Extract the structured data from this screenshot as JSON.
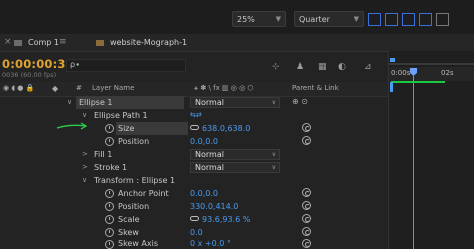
{
  "viewer": {
    "zoom": "25%",
    "resolution": "Quarter"
  },
  "tabs": [
    {
      "label": "Comp 1",
      "color": "#6b6b6b"
    },
    {
      "label": "website-Mograph-1",
      "color": "#8a6d3b"
    }
  ],
  "time_display": {
    "timecode": "0:00:00:36",
    "fps": "0036 (60.00 fps)"
  },
  "search": {
    "value": "ρ∙"
  },
  "columns": {
    "layer_name": "Layer Name",
    "parent_link": "Parent & Link"
  },
  "timeline": {
    "ruler": [
      "0:00s",
      "02s"
    ],
    "accent": "#4b9bf0",
    "playhead_color": "#6aa3ff",
    "workbar_color": "#18c83e"
  },
  "layers": [
    {
      "name": "Ellipse 1",
      "mode": "Normal"
    },
    {
      "name": "Ellipse Path 1"
    },
    {
      "name": "Size",
      "value": "638.0,638.0"
    },
    {
      "name": "Position",
      "value": "0.0,0.0"
    },
    {
      "name": "Fill 1",
      "mode": "Normal"
    },
    {
      "name": "Stroke 1",
      "mode": "Normal"
    },
    {
      "name": "Transform : Ellipse 1"
    },
    {
      "name": "Anchor Point",
      "value": "0.0,0.0"
    },
    {
      "name": "Position",
      "value": "330.0,414.0"
    },
    {
      "name": "Scale",
      "value": "93.6,93.6 %"
    },
    {
      "name": "Skew",
      "value": "0.0"
    },
    {
      "name": "Skew Axis",
      "value": "0 x +0.0 °"
    }
  ]
}
